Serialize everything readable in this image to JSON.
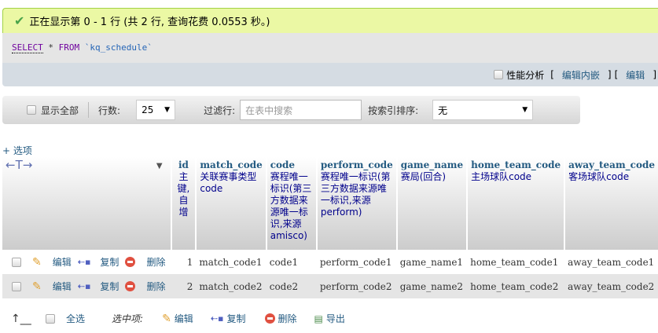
{
  "message": {
    "text": "正在显示第 0 - 1 行 (共 2 行, 查询花费 0.0553 秒。)"
  },
  "sql": {
    "select": "SELECT",
    "star": "*",
    "from": "FROM",
    "table": "`kq_schedule`"
  },
  "infobar": {
    "profiling": "性能分析",
    "edit_inline": "编辑内嵌",
    "edit": "编辑",
    "lb": "[",
    "rb": "]"
  },
  "toolbar": {
    "show_all": "显示全部",
    "rows_label": "行数:",
    "rows_value": "25",
    "filter_label": "过滤行:",
    "filter_placeholder": "在表中搜索",
    "sort_label": "按索引排序:",
    "sort_value": "无"
  },
  "options": "+ 选项",
  "columns": [
    {
      "name": "id",
      "comment": "主键,自增"
    },
    {
      "name": "match_code",
      "comment": "关联赛事类型code"
    },
    {
      "name": "code",
      "comment": "赛程唯一标识(第三方数据来源唯一标识,来源amisco)"
    },
    {
      "name": "perform_code",
      "comment": "赛程唯一标识(第三方数据来源唯一标识,来源perform)"
    },
    {
      "name": "game_name",
      "comment": "赛局(回合)"
    },
    {
      "name": "home_team_code",
      "comment": "主场球队code"
    },
    {
      "name": "away_team_code",
      "comment": "客场球队code"
    }
  ],
  "row_actions": {
    "edit": "编辑",
    "copy": "复制",
    "delete": "删除"
  },
  "rows": [
    [
      "1",
      "match_code1",
      "code1",
      "perform_code1",
      "game_name1",
      "home_team_code1",
      "away_team_code1"
    ],
    [
      "2",
      "match_code2",
      "code2",
      "perform_code2",
      "game_name2",
      "home_team_code2",
      "away_team_code2"
    ]
  ],
  "footer": {
    "select_all": "全选",
    "with_selected": "选中项:",
    "edit": "编辑",
    "copy": "复制",
    "delete": "删除",
    "export": "导出"
  }
}
